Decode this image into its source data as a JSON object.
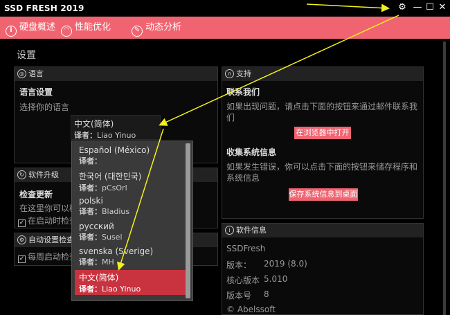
{
  "app": {
    "title": "SSD FRESH 2019"
  },
  "window": {
    "settings_icon": "gear-icon",
    "minimize": "—",
    "maximize": "☐",
    "close": "✕"
  },
  "nav": {
    "items": [
      {
        "label": "硬盘概述",
        "icon": "info-icon"
      },
      {
        "label": "性能优化",
        "icon": "speedometer-icon"
      },
      {
        "label": "动态分析",
        "icon": "pencil-icon"
      }
    ]
  },
  "page": {
    "title": "设置"
  },
  "language": {
    "header": "语言",
    "heading": "语言设置",
    "prompt": "选择你的语言",
    "selected_name": "中文(简体)",
    "translator_label": "译者：",
    "selected_translator": "Liao Yinuo",
    "options": [
      {
        "name": "Español (México)",
        "translator": ""
      },
      {
        "name": "한국어 (대한민국)",
        "translator": "pCsOrl"
      },
      {
        "name": "polski",
        "translator": "Bladius"
      },
      {
        "name": "русский",
        "translator": "Susel"
      },
      {
        "name": "svenska (Sverige)",
        "translator": "MH"
      },
      {
        "name": "中文(简体)",
        "translator": "Liao Yinuo"
      }
    ]
  },
  "upgrade": {
    "header": "软件升级",
    "check_heading": "检查更新",
    "check_text": "在这里你可以检",
    "startup_check": "在启动时检查"
  },
  "auto": {
    "header": "自动设置检查",
    "weekly": "每周启动检查"
  },
  "support": {
    "header": "支持",
    "contact_heading": "联系我们",
    "contact_text": "如果出现问题，请点击下面的按钮来通过邮件联系我们",
    "open_browser_button": "在浏览器中打开",
    "collect_heading": "收集系统信息",
    "collect_text": "如果发生错误，你可以点击下面的按钮来储存程序和系统信息",
    "save_button": "保存系统信息到桌面"
  },
  "info": {
    "header": "软件信息",
    "product": "SSDFresh",
    "version_label": "版本：",
    "version_value": "2019 (8.0)",
    "core_label": "核心版本",
    "core_value": "5.010",
    "build_label": "版本号",
    "build_value": "8",
    "copyright": "© Abelssoft"
  },
  "colors": {
    "accent": "#f06471",
    "selected": "#c8333f",
    "arrow": "#f4f01b"
  }
}
